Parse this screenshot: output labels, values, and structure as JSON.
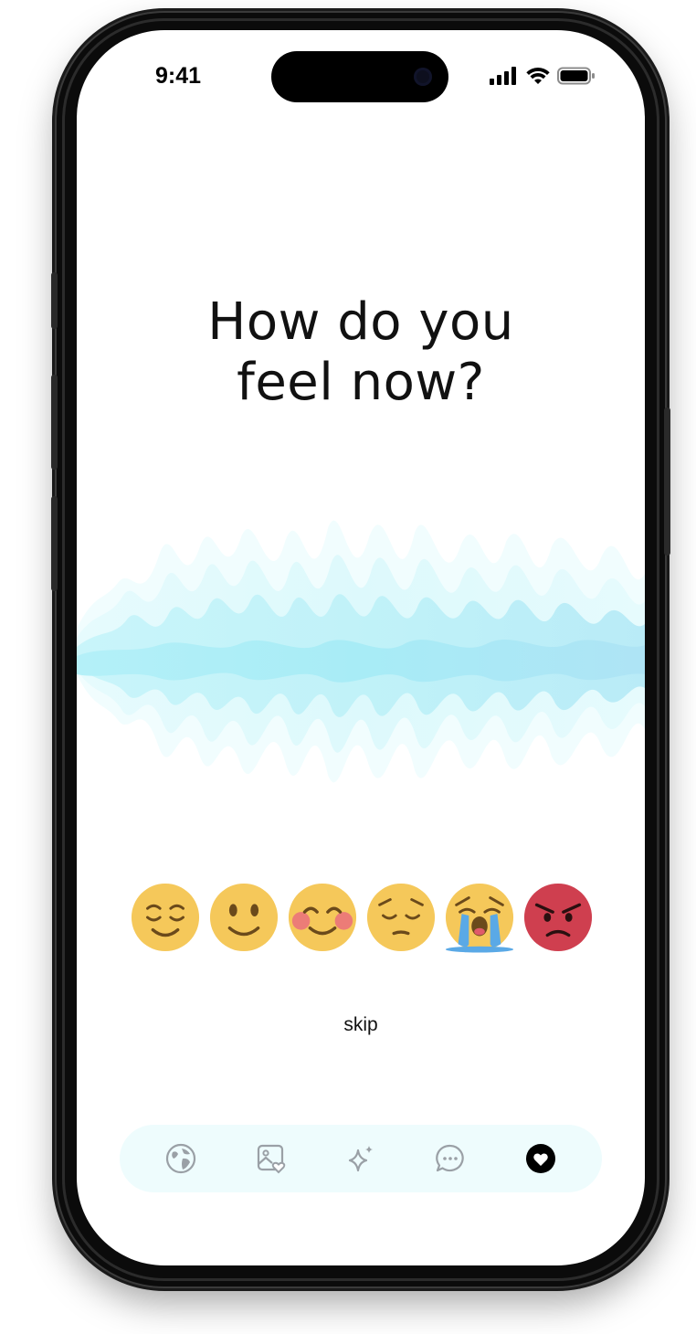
{
  "status_bar": {
    "time": "9:41",
    "signal_icon": "cellular-signal-icon",
    "wifi_icon": "wifi-icon",
    "battery_icon": "battery-icon"
  },
  "prompt": {
    "line1": "How do you",
    "line2": "feel now?"
  },
  "colors": {
    "wave_light": "#eafcff",
    "wave_mid": "#cdf6fb",
    "wave_dark": "#b6ecf7",
    "tabbar_bg": "#eefcfd",
    "active_tab": "#000000",
    "inactive_tab": "#9aa0a6"
  },
  "moods": [
    {
      "icon": "relieved-face-icon"
    },
    {
      "icon": "slightly-smiling-face-icon"
    },
    {
      "icon": "smiling-face-with-blush-icon"
    },
    {
      "icon": "pensive-face-icon"
    },
    {
      "icon": "loudly-crying-face-icon"
    },
    {
      "icon": "angry-face-icon"
    }
  ],
  "skip_label": "skip",
  "tabs": [
    {
      "icon": "globe-icon",
      "active": false
    },
    {
      "icon": "photo-heart-icon",
      "active": false
    },
    {
      "icon": "sparkle-icon",
      "active": false
    },
    {
      "icon": "chat-bubble-icon",
      "active": false
    },
    {
      "icon": "heart-icon",
      "active": true
    }
  ]
}
